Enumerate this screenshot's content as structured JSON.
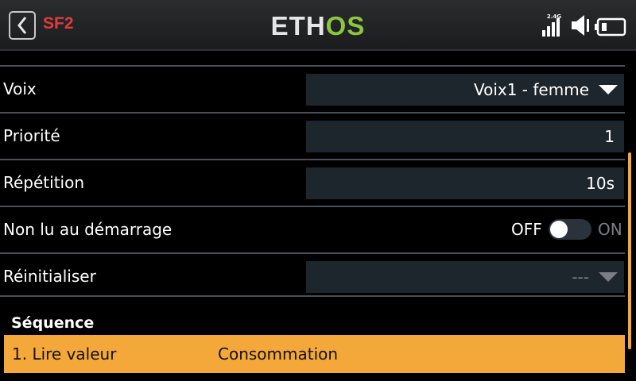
{
  "header": {
    "page_id": "SF2",
    "logo_part1": "ETH",
    "logo_part2": "OS",
    "rf_band": "2.4G"
  },
  "rows": [
    {
      "label": "Voix",
      "value": "Voix1 - femme",
      "type": "dropdown"
    },
    {
      "label": "Priorité",
      "value": "1",
      "type": "number"
    },
    {
      "label": "Répétition",
      "value": "10s",
      "type": "number"
    },
    {
      "label": "Non lu au démarrage",
      "type": "toggle",
      "off_label": "OFF",
      "on_label": "ON",
      "state": "off"
    },
    {
      "label": "Réinitialiser",
      "value": "---",
      "type": "dropdown",
      "disabled": true
    }
  ],
  "sequence": {
    "title": "Séquence",
    "items": [
      {
        "action": "1. Lire valeur",
        "value": "Consommation",
        "selected": true
      }
    ]
  },
  "colors": {
    "accent": "#f5a83a",
    "page_id": "#e03c3c",
    "logo_green": "#8cc63f",
    "field_bg": "#1e262d"
  },
  "icons": [
    "back-arrow-icon",
    "rf-signal-icon",
    "speaker-icon",
    "battery-icon",
    "dropdown-arrow-icon"
  ]
}
